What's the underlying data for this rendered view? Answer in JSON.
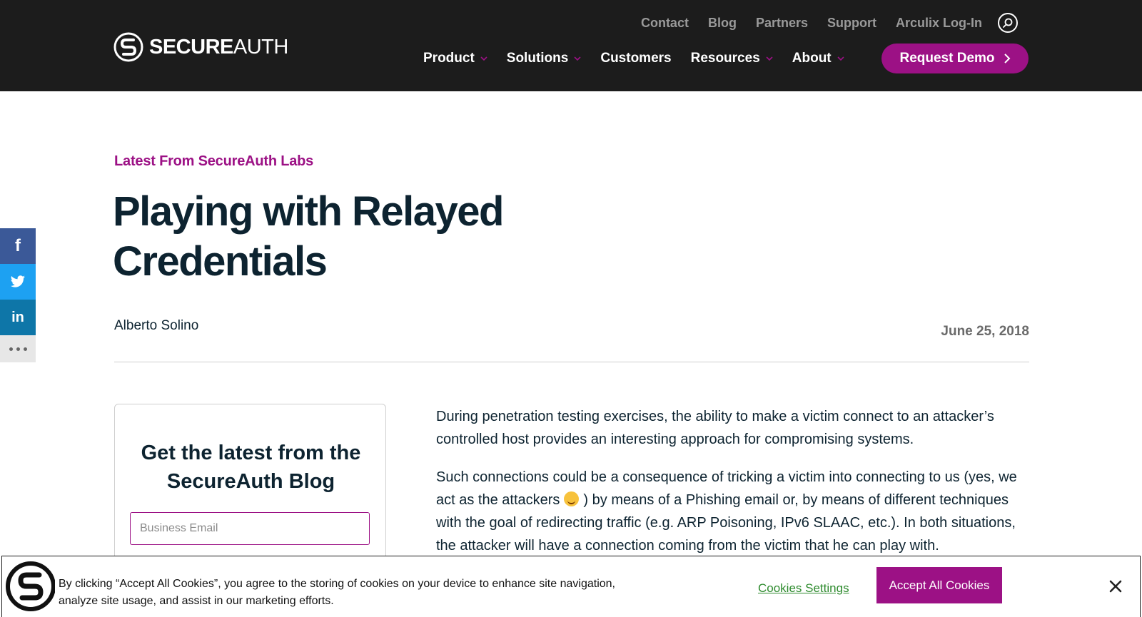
{
  "header": {
    "logo_strong": "SECURE",
    "logo_light": "AUTH",
    "utility_links": [
      "Contact",
      "Blog",
      "Partners",
      "Support",
      "Arculix Log-In"
    ],
    "main_nav": [
      {
        "label": "Product",
        "has_dropdown": true
      },
      {
        "label": "Solutions",
        "has_dropdown": true
      },
      {
        "label": "Customers",
        "has_dropdown": false
      },
      {
        "label": "Resources",
        "has_dropdown": true
      },
      {
        "label": "About",
        "has_dropdown": true
      }
    ],
    "cta_label": "Request Demo",
    "search_icon": "search-icon"
  },
  "social": {
    "facebook_glyph": "f",
    "linkedin_glyph": "in",
    "icons": [
      "facebook-icon",
      "twitter-icon",
      "linkedin-icon",
      "more-icon"
    ]
  },
  "article": {
    "eyebrow": "Latest From SecureAuth Labs",
    "title": "Playing with Relayed Credentials",
    "author": "Alberto Solino",
    "date": "June 25, 2018",
    "paragraphs": {
      "p1": "During penetration testing exercises, the ability to make a victim connect to an attacker’s controlled host provides an interesting approach for compromising systems.",
      "p2_before": "Such connections could be a consequence of tricking a victim into connecting to us (yes, we act as the attackers",
      "p2_after": ") by means of a Phishing email or, by means of different techniques with the goal of redirecting traffic (e.g. ARP Poisoning, IPv6 SLAAC, etc.). In both situations, the attacker will have a connection coming from the victim that he can play with."
    }
  },
  "subscribe": {
    "title": "Get the latest from the SecureAuth Blog",
    "email_placeholder": "Business Email"
  },
  "cookie_banner": {
    "text": "By clicking “Accept All Cookies”, you agree to the storing of cookies on your device to enhance site navigation, analyze site usage, and assist in our marketing efforts.",
    "settings_label": "Cookies Settings",
    "accept_label": "Accept All Cookies"
  },
  "colors": {
    "header_bg": "#1c1c1c",
    "brand_purple": "#9c1185",
    "heading": "#0d2330",
    "cookie_link": "#2e8b2e"
  }
}
